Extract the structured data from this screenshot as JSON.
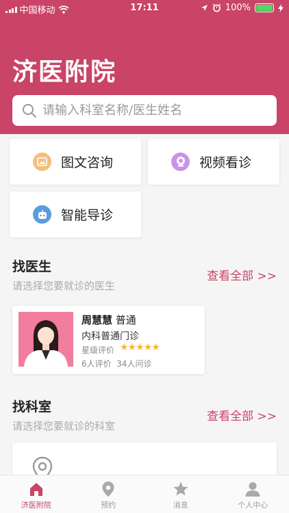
{
  "status_bar": {
    "carrier": "中国移动",
    "time": "17:11",
    "battery": "100%"
  },
  "header": {
    "title": "济医附院",
    "search_placeholder": "请输入科室名称/医生姓名"
  },
  "services": [
    {
      "label": "图文咨询",
      "icon": "image-chat-icon",
      "color": "#f3bf7e"
    },
    {
      "label": "视频看诊",
      "icon": "video-camera-icon",
      "color": "#c993e6"
    },
    {
      "label": "智能导诊",
      "icon": "robot-icon",
      "color": "#5b9be0"
    }
  ],
  "find_doctor": {
    "title": "找医生",
    "subtitle": "请选择您要就诊的医生",
    "view_all": "查看全部 >>",
    "doctor": {
      "name": "周慧慧",
      "title": "普通",
      "department": "内科普通门诊",
      "rating_label": "星级评价",
      "stars": 5,
      "stats": "6人评价  34人问诊"
    }
  },
  "find_department": {
    "title": "找科室",
    "subtitle": "请选择您要就诊的科室",
    "view_all": "查看全部 >>"
  },
  "tabbar": [
    {
      "label": "济医附院",
      "icon": "home-icon",
      "active": true
    },
    {
      "label": "预约",
      "icon": "location-pin-icon",
      "active": false
    },
    {
      "label": "消息",
      "icon": "star-icon",
      "active": false
    },
    {
      "label": "个人中心",
      "icon": "person-icon",
      "active": false
    }
  ],
  "colors": {
    "brand": "#c94466",
    "background": "#f5f5f5"
  }
}
